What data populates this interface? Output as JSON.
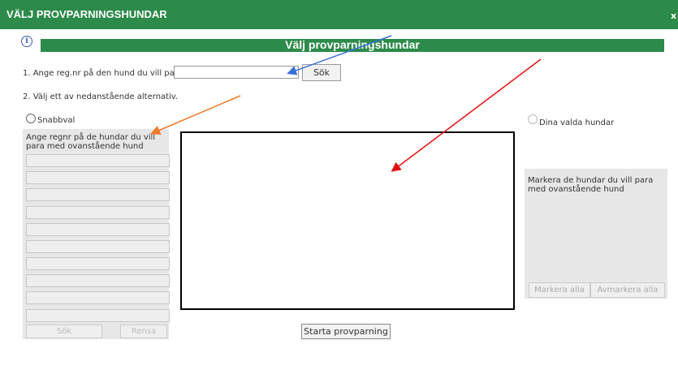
{
  "window": {
    "title": "VÄLJ PROVPARNINGSHUNDAR",
    "close_label": "x"
  },
  "header": {
    "info_glyph": "i",
    "heading": "Välj provparningshundar"
  },
  "step1": {
    "label": "1. Ange reg.nr på den hund du vill para:",
    "input_value": "",
    "search_button": "Sök"
  },
  "step2": {
    "label": "2. Välj ett av nedanstående alternativ."
  },
  "quick_select": {
    "radio_label": "Snabbval",
    "description": "Ange regnr på de hundar du vill para med ovanstående hund",
    "fields": [
      "",
      "",
      "",
      "",
      "",
      "",
      "",
      "",
      "",
      ""
    ],
    "search_button": "Sök",
    "clear_button": "Rensa"
  },
  "selected_dogs": {
    "radio_label": "Dina valda hundar",
    "description": "Markera de hundar du vill para med ovanstående hund",
    "select_all_button": "Markera alla",
    "deselect_all_button": "Avmarkera alla"
  },
  "footer": {
    "start_button": "Starta provparning"
  },
  "colors": {
    "accent_green": "#2c8a4a",
    "annotation_blue": "#3a6fd8",
    "annotation_orange": "#f07a2a",
    "annotation_red": "#e01010"
  }
}
